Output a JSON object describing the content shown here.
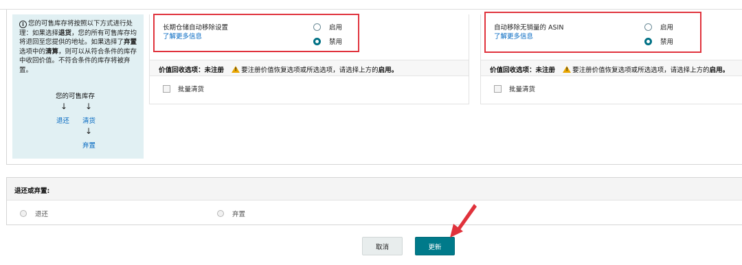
{
  "info_panel": {
    "text_1": "您的可售库存将按照以下方式进行处理：如果选择",
    "text_return": "退货",
    "text_2": "，您的所有可售库存均将退回至您提供的地址。如果选择了",
    "text_dispose": "弃置",
    "text_3": "选项中的",
    "text_liquidate": "清算",
    "text_4": "，则可以从符合条件的库存中收回价值。不符合条件的库存将被弃置。",
    "diagram": {
      "root": "您的可售库存",
      "left": "退还",
      "middle": "清货",
      "bottom": "弃置"
    }
  },
  "card_long_term": {
    "title": "长期仓储自动移除设置",
    "learn_more": "了解更多信息",
    "enable_label": "启用",
    "disable_label": "禁用",
    "selected": "禁用",
    "recovery_label": "价值回收选项：",
    "recovery_status": "未注册",
    "warning_text": "要注册价值恢复选项或所选选项，请选择上方的",
    "warning_bold": "启用。",
    "bulk_label": "批量清货"
  },
  "card_unsellable": {
    "title": "自动移除无销量的 ASIN",
    "learn_more": "了解更多信息",
    "enable_label": "启用",
    "disable_label": "禁用",
    "selected": "禁用",
    "recovery_label": "价值回收选项：",
    "recovery_status": "未注册",
    "warning_text": "要注册价值恢复选项或所选选项，请选择上方的",
    "warning_bold": "启用。",
    "bulk_label": "批量清货"
  },
  "return_or_dispose": {
    "heading": "退还或弃置:",
    "option_return": "退还",
    "option_dispose": "弃置"
  },
  "actions": {
    "cancel": "取消",
    "update": "更新"
  },
  "colors": {
    "accent": "#007185",
    "link": "#0066c0",
    "highlight_box": "#e0323c",
    "info_bg": "#e1f0f3",
    "warning": "#e8a500"
  }
}
